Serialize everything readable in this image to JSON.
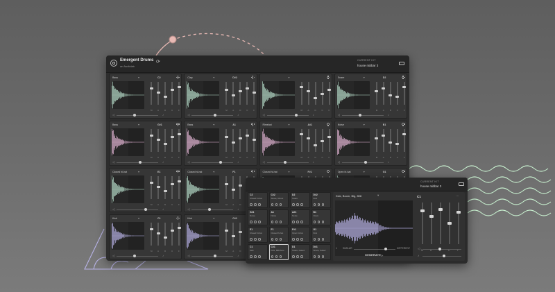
{
  "colors": {
    "background": "#6a6a6a",
    "window": "#2d2d2d",
    "wave_green": "#b9e0cc",
    "wave_pink": "#e7b7d8",
    "wave_blue": "#b9b4e8",
    "deco_line_green": "#c8f0cf",
    "deco_line_pink": "#e8b9b4"
  },
  "main_window": {
    "title": "Emergent Drums",
    "subtitle": "an Audiolab",
    "current_kit_label": "CURRENT KIT",
    "current_kit_name": "house rabbar 3",
    "icons": {
      "logo": "app-logo-icon",
      "refresh": "refresh-icon",
      "folder": "folder-icon"
    },
    "pads": [
      {
        "name": "Bass",
        "note": "C2",
        "color": "#b9e0cc"
      },
      {
        "name": "Clap",
        "note": "D#2",
        "color": "#b9e0cc"
      },
      {
        "name": "",
        "note": "",
        "color": "#b9e0cc"
      },
      {
        "name": "Snare",
        "note": "D2",
        "color": "#b9e0cc"
      },
      {
        "name": "Bass",
        "note": "G#1",
        "color": "#e7b7d8"
      },
      {
        "name": "Bass",
        "note": "A1",
        "color": "#e7b7d8"
      },
      {
        "name": "Rimshot",
        "note": "A#1",
        "color": "#e7b7d8"
      },
      {
        "name": "Noise",
        "note": "B1",
        "color": "#e7b7d8"
      },
      {
        "name": "Closed hi-hat",
        "note": "E1",
        "color": "#b9e0cc"
      },
      {
        "name": "Closed hi-hat",
        "note": "F1",
        "color": "#b9e0cc"
      },
      {
        "name": "Closed hi-hat",
        "note": "F#1",
        "color": "#b9e0cc"
      },
      {
        "name": "Open hi-hat",
        "note": "G1",
        "color": "#b9e0cc"
      },
      {
        "name": "Kick",
        "note": "C1",
        "color": "#b9b4e8"
      },
      {
        "name": "Kick",
        "note": "C#1",
        "color": "#b9b4e8"
      },
      {
        "name": "",
        "note": "",
        "color": "#b9b4e8"
      },
      {
        "name": "",
        "note": "",
        "color": "#b9b4e8"
      }
    ],
    "fader_labels": [
      "M",
      "A",
      "D",
      "C",
      "F"
    ]
  },
  "secondary_window": {
    "current_kit_label": "CURRENT KIT",
    "current_kit_name": "house rabbar 3",
    "cells": [
      {
        "note": "C2",
        "name": "Closed hi-hat"
      },
      {
        "note": "C#2",
        "name": "Snare, Ghost"
      },
      {
        "note": "D2",
        "name": "Snare"
      },
      {
        "note": "D#2",
        "name": "Kick"
      },
      {
        "note": "G#1",
        "name": "Noise"
      },
      {
        "note": "A1",
        "name": "Noise"
      },
      {
        "note": "A#1",
        "name": "Noise"
      },
      {
        "note": "B1",
        "name": "Clave"
      },
      {
        "note": "E1",
        "name": "Closed hi-hat"
      },
      {
        "note": "F1",
        "name": "Closed hi-hat"
      },
      {
        "note": "F#1",
        "name": "Open hi-hat"
      },
      {
        "note": "G1",
        "name": "Kick"
      },
      {
        "note": "C1",
        "name": "Kick"
      },
      {
        "note": "C#1",
        "name": "Kick, 808 Ana..."
      },
      {
        "note": "D1",
        "name": "Snare, Gated"
      },
      {
        "note": "D#1",
        "name": "Snare, Gated"
      }
    ],
    "selected_index": 13,
    "detail": {
      "sample_name": "Kick, Boom, Big, 808",
      "note": "C1",
      "fader_labels": [
        "M",
        "A",
        "D",
        "C",
        "F"
      ],
      "small_left": "1",
      "similar_label": "SIMILAR",
      "different_label": "DIFFERENT",
      "generate_label": "GENERATE",
      "volume_icon": "volume-icon",
      "pitch_icon": "pitch-icon"
    }
  }
}
